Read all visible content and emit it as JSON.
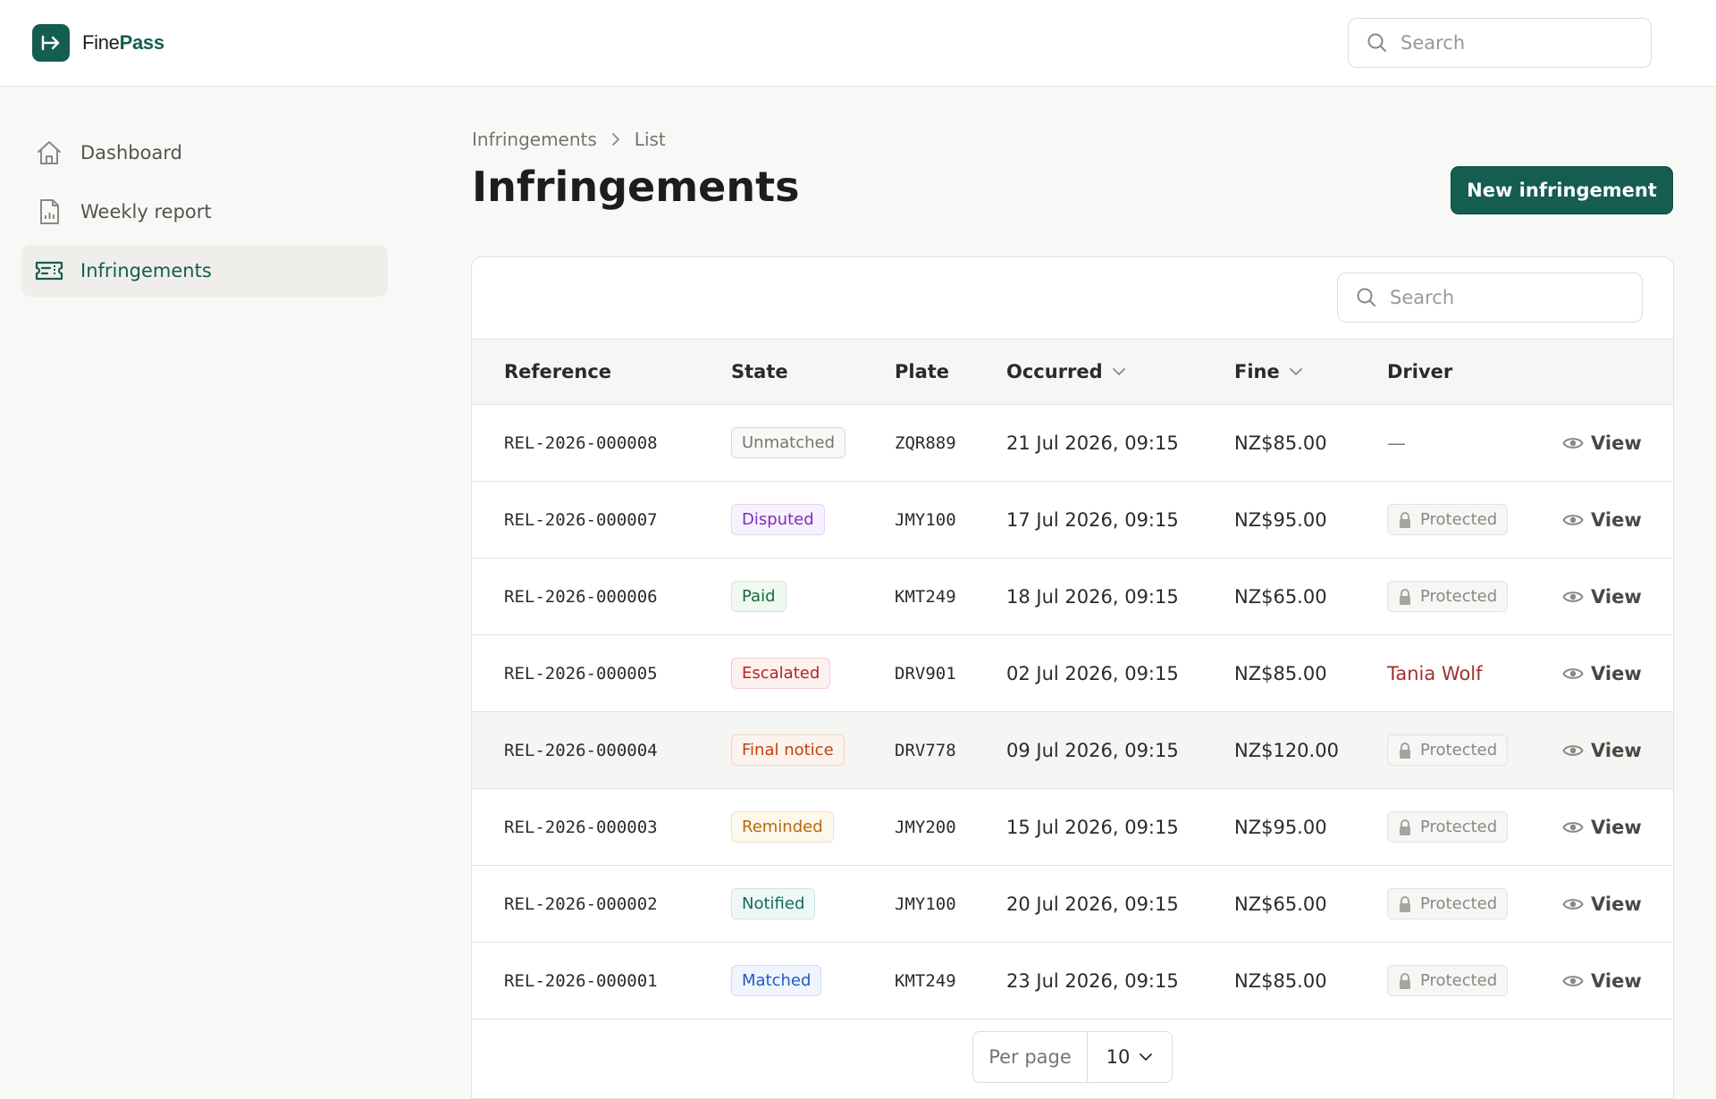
{
  "app": {
    "name_part1": "Fine",
    "name_part2": "Pass"
  },
  "top_search": {
    "placeholder": "Search"
  },
  "sidebar": {
    "items": [
      {
        "label": "Dashboard",
        "icon": "home-icon",
        "active": false
      },
      {
        "label": "Weekly report",
        "icon": "report-icon",
        "active": false
      },
      {
        "label": "Infringements",
        "icon": "ticket-icon",
        "active": true
      }
    ]
  },
  "breadcrumb": {
    "root": "Infringements",
    "current": "List"
  },
  "page": {
    "title": "Infringements",
    "primary_button": "New infringement"
  },
  "table_search": {
    "placeholder": "Search"
  },
  "table": {
    "columns": {
      "reference": "Reference",
      "state": "State",
      "plate": "Plate",
      "occurred": "Occurred",
      "fine": "Fine",
      "driver": "Driver"
    },
    "view_label": "View",
    "protected_label": "Protected",
    "rows": [
      {
        "reference": "REL-2026-000008",
        "state": "Unmatched",
        "state_color": "#77756f",
        "state_bg": "#f8f8f6",
        "state_border": "#dcdbd7",
        "plate": "ZQR889",
        "occurred": "21 Jul 2026, 09:15",
        "fine": "NZ$85.00",
        "driver": "—",
        "driver_type": "none"
      },
      {
        "reference": "REL-2026-000007",
        "state": "Disputed",
        "state_color": "#7a2fc4",
        "state_bg": "#f7f1fd",
        "state_border": "#e3d2f6",
        "plate": "JMY100",
        "occurred": "17 Jul 2026, 09:15",
        "fine": "NZ$95.00",
        "driver": "Protected",
        "driver_type": "protected"
      },
      {
        "reference": "REL-2026-000006",
        "state": "Paid",
        "state_color": "#1b6b3b",
        "state_bg": "#eff8f1",
        "state_border": "#cfe7d6",
        "plate": "KMT249",
        "occurred": "18 Jul 2026, 09:15",
        "fine": "NZ$65.00",
        "driver": "Protected",
        "driver_type": "protected"
      },
      {
        "reference": "REL-2026-000005",
        "state": "Escalated",
        "state_color": "#b3261e",
        "state_bg": "#fdf1f0",
        "state_border": "#f2cfcc",
        "plate": "DRV901",
        "occurred": "02 Jul 2026, 09:15",
        "fine": "NZ$85.00",
        "driver": "Tania Wolf",
        "driver_type": "name"
      },
      {
        "reference": "REL-2026-000004",
        "state": "Final notice",
        "state_color": "#c2410c",
        "state_bg": "#fdf3ee",
        "state_border": "#f5d4c4",
        "plate": "DRV778",
        "occurred": "09 Jul 2026, 09:15",
        "fine": "NZ$120.00",
        "driver": "Protected",
        "driver_type": "protected",
        "highlight": true
      },
      {
        "reference": "REL-2026-000003",
        "state": "Reminded",
        "state_color": "#b46a0a",
        "state_bg": "#fdf7ec",
        "state_border": "#f2dfbc",
        "plate": "JMY200",
        "occurred": "15 Jul 2026, 09:15",
        "fine": "NZ$95.00",
        "driver": "Protected",
        "driver_type": "protected"
      },
      {
        "reference": "REL-2026-000002",
        "state": "Notified",
        "state_color": "#0f6b63",
        "state_bg": "#eef8f6",
        "state_border": "#cbe6e1",
        "plate": "JMY100",
        "occurred": "20 Jul 2026, 09:15",
        "fine": "NZ$65.00",
        "driver": "Protected",
        "driver_type": "protected"
      },
      {
        "reference": "REL-2026-000001",
        "state": "Matched",
        "state_color": "#2659c4",
        "state_bg": "#eff4fd",
        "state_border": "#cfdcf5",
        "plate": "KMT249",
        "occurred": "23 Jul 2026, 09:15",
        "fine": "NZ$85.00",
        "driver": "Protected",
        "driver_type": "protected"
      }
    ]
  },
  "pagination": {
    "per_page_label": "Per page",
    "per_page_value": "10"
  },
  "colors": {
    "brand": "#155d51"
  }
}
